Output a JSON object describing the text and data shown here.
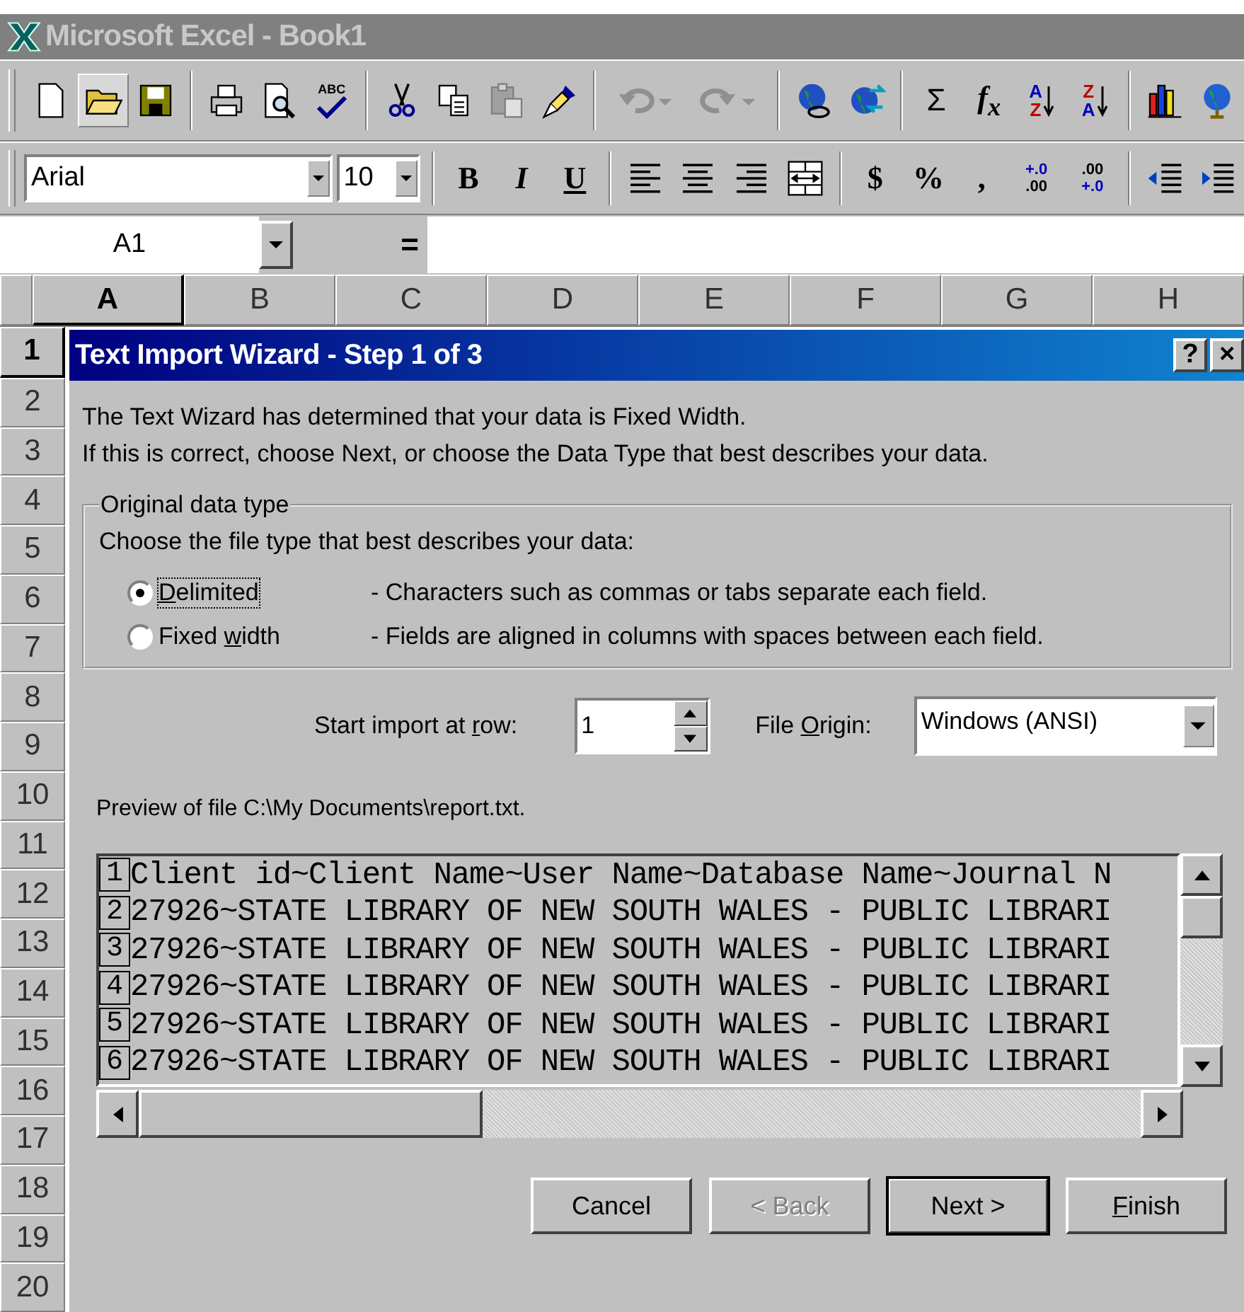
{
  "window": {
    "title": "Microsoft Excel - Book1"
  },
  "standard_toolbar": {
    "spelling": "ABC",
    "autosum": "Σ",
    "function": "f$_{x}$",
    "sort_ascending": {
      "top": "A",
      "bottom": "Z"
    },
    "sort_descending": {
      "top": "Z",
      "bottom": "A"
    }
  },
  "formatting_toolbar": {
    "font": "Arial",
    "font_size": "10",
    "bold": "B",
    "italic": "I",
    "underline": "U",
    "currency": "$",
    "percent": "%",
    "comma": ",",
    "increase_decimal": {
      "top": "+.0",
      "bottom": ".00"
    },
    "decrease_decimal": {
      "top": ".00",
      "bottom": "+.0"
    }
  },
  "formula_bar": {
    "name_box": "A1",
    "equals": "="
  },
  "columns": [
    {
      "label": "A",
      "selected": true
    },
    {
      "label": "B",
      "selected": false
    },
    {
      "label": "C",
      "selected": false
    },
    {
      "label": "D",
      "selected": false
    },
    {
      "label": "E",
      "selected": false
    },
    {
      "label": "F",
      "selected": false
    },
    {
      "label": "G",
      "selected": false
    },
    {
      "label": "H",
      "selected": false
    }
  ],
  "rows": [
    {
      "label": "1",
      "selected": true
    },
    {
      "label": "2",
      "selected": false
    },
    {
      "label": "3",
      "selected": false
    },
    {
      "label": "4",
      "selected": false
    },
    {
      "label": "5",
      "selected": false
    },
    {
      "label": "6",
      "selected": false
    },
    {
      "label": "7",
      "selected": false
    },
    {
      "label": "8",
      "selected": false
    },
    {
      "label": "9",
      "selected": false
    },
    {
      "label": "10",
      "selected": false
    },
    {
      "label": "11",
      "selected": false
    },
    {
      "label": "12",
      "selected": false
    },
    {
      "label": "13",
      "selected": false
    },
    {
      "label": "14",
      "selected": false
    },
    {
      "label": "15",
      "selected": false
    },
    {
      "label": "16",
      "selected": false
    },
    {
      "label": "17",
      "selected": false
    },
    {
      "label": "18",
      "selected": false
    },
    {
      "label": "19",
      "selected": false
    },
    {
      "label": "20",
      "selected": false
    }
  ],
  "dialog": {
    "title": "Text Import Wizard - Step 1 of 3",
    "help": "?",
    "close": "×",
    "intro": [
      "The Text Wizard has determined that your data is Fixed Width.",
      "If this is correct, choose Next, or choose the Data Type that best describes your data."
    ],
    "group": {
      "title": "Original data type",
      "prompt": "Choose the file type that best describes your data:",
      "options": [
        {
          "label": {
            "key": "D",
            "post": "elimited"
          },
          "description": "- Characters such as commas or tabs separate each field.",
          "selected": true
        },
        {
          "label": {
            "pre": "Fixed ",
            "key": "w",
            "post": "idth"
          },
          "description": "- Fields are aligned in columns with spaces between each field.",
          "selected": false
        }
      ]
    },
    "start_row": {
      "label": {
        "pre": "Start import at ",
        "key": "r",
        "post": "ow:"
      },
      "value": "1"
    },
    "file_origin": {
      "label": {
        "pre": "File ",
        "key": "O",
        "post": "rigin:"
      },
      "value": "Windows (ANSI)"
    },
    "preview": {
      "label": "Preview of file C:\\My Documents\\report.txt.",
      "lines": [
        {
          "number": "1",
          "text": "Client id~Client Name~User Name~Database Name~Journal N"
        },
        {
          "number": "2",
          "text": "27926~STATE LIBRARY OF NEW SOUTH WALES - PUBLIC LIBRARI"
        },
        {
          "number": "3",
          "text": "27926~STATE LIBRARY OF NEW SOUTH WALES - PUBLIC LIBRARI"
        },
        {
          "number": "4",
          "text": "27926~STATE LIBRARY OF NEW SOUTH WALES - PUBLIC LIBRARI"
        },
        {
          "number": "5",
          "text": "27926~STATE LIBRARY OF NEW SOUTH WALES - PUBLIC LIBRARI"
        },
        {
          "number": "6",
          "text": "27926~STATE LIBRARY OF NEW SOUTH WALES - PUBLIC LIBRARI"
        }
      ]
    },
    "buttons": [
      {
        "label": {
          "pre": "Cancel"
        },
        "disabled": false,
        "default": false
      },
      {
        "label": {
          "pre": "< Back"
        },
        "disabled": true,
        "default": false
      },
      {
        "label": {
          "pre": "Next >"
        },
        "disabled": false,
        "default": true
      },
      {
        "label": {
          "key": "F",
          "post": "inish"
        },
        "disabled": false,
        "default": false
      }
    ]
  }
}
